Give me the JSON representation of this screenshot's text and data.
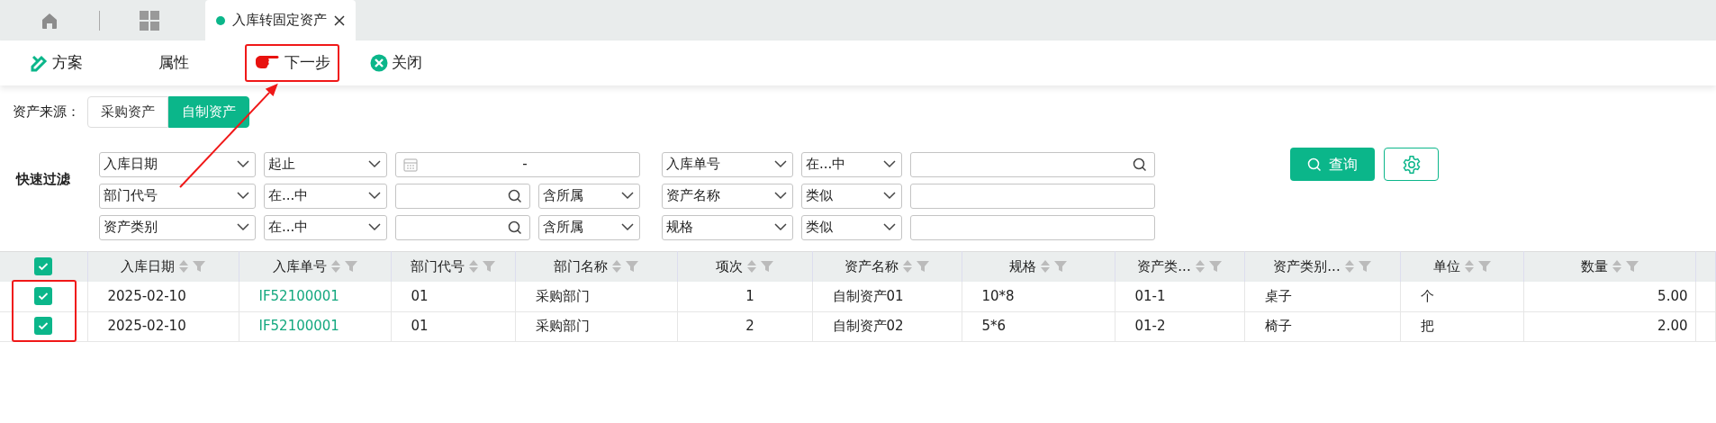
{
  "tabs": [
    {
      "kind": "home",
      "selected": false
    },
    {
      "kind": "apps",
      "selected": false
    },
    {
      "kind": "page",
      "label": "入库转固定资产",
      "selected": true
    }
  ],
  "toolbar": [
    {
      "label": "方案",
      "kind": "scheme",
      "highlighted": false
    },
    {
      "label": "属性",
      "kind": "plain",
      "highlighted": false
    },
    {
      "label": "下一步",
      "kind": "next",
      "highlighted": true
    },
    {
      "label": "关闭",
      "kind": "close",
      "highlighted": false
    }
  ],
  "source": {
    "label": "资产来源：",
    "options": [
      {
        "label": "采购资产",
        "selected": false
      },
      {
        "label": "自制资产",
        "selected": true
      }
    ]
  },
  "filter": {
    "title": "快速过滤",
    "rows": [
      {
        "field": "入库日期",
        "operator": "起止",
        "value": {
          "kind": "daterange",
          "text": "-"
        },
        "right_field": "入库单号",
        "right_operator": "在...中",
        "right_value": {
          "kind": "search"
        }
      },
      {
        "field": "部门代号",
        "operator": "在...中",
        "value": {
          "kind": "search"
        },
        "scope": "含所属",
        "right_field": "资产名称",
        "right_operator": "类似",
        "right_value": {
          "kind": "text"
        }
      },
      {
        "field": "资产类别",
        "operator": "在...中",
        "value": {
          "kind": "search"
        },
        "scope": "含所属",
        "right_field": "规格",
        "right_operator": "类似",
        "right_value": {
          "kind": "text"
        }
      }
    ],
    "query_button": "查询"
  },
  "table": {
    "all_checked": true,
    "rows_highlighted": true,
    "columns": [
      {
        "label": "入库日期",
        "kind": "text"
      },
      {
        "label": "入库单号",
        "kind": "link"
      },
      {
        "label": "部门代号",
        "kind": "text"
      },
      {
        "label": "部门名称",
        "kind": "text"
      },
      {
        "label": "项次",
        "kind": "center"
      },
      {
        "label": "资产名称",
        "kind": "text"
      },
      {
        "label": "规格",
        "kind": "text"
      },
      {
        "label": "资产类...",
        "kind": "text"
      },
      {
        "label": "资产类别...",
        "kind": "text"
      },
      {
        "label": "单位",
        "kind": "text"
      },
      {
        "label": "数量",
        "kind": "number"
      }
    ],
    "rows": [
      {
        "checked": true,
        "cells": [
          "2025-02-10",
          "IF52100001",
          "01",
          "采购部门",
          "1",
          "自制资产01",
          "10*8",
          "01-1",
          "桌子",
          "个",
          "5.00"
        ]
      },
      {
        "checked": true,
        "cells": [
          "2025-02-10",
          "IF52100001",
          "01",
          "采购部门",
          "2",
          "自制资产02",
          "5*6",
          "01-2",
          "椅子",
          "把",
          "2.00"
        ]
      }
    ]
  }
}
